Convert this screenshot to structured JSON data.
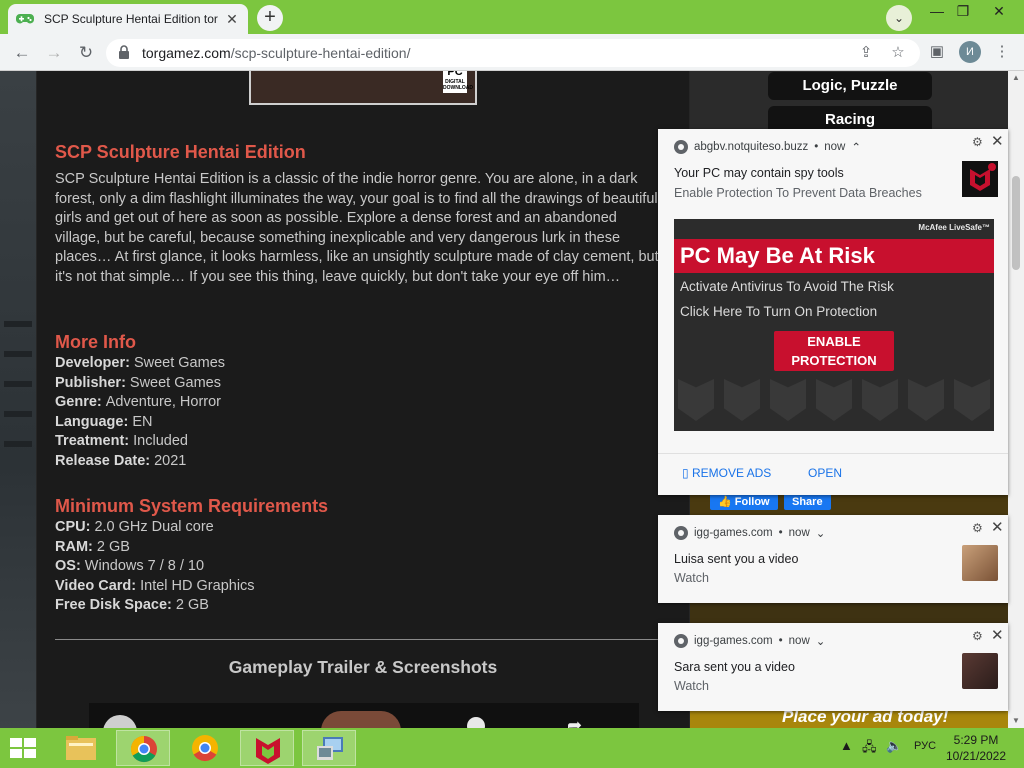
{
  "browser": {
    "tab_title": "SCP Sculpture Hentai Edition tor",
    "url_domain": "torgamez.com",
    "url_path": "/scp-sculpture-hentai-edition/",
    "profile_initial": "И"
  },
  "page": {
    "title": "SCP Sculpture Hentai Edition",
    "description": "SCP Sculpture Hentai Edition is a classic of the indie horror genre. You are alone, in a dark forest, only a dim flashlight illuminates the way, your goal is to find all the drawings of beautiful girls and get out of here as soon as possible. Explore a dense forest and an abandoned village, but be careful, because something inexplicable and very dangerous lurk in these places… At first glance, it looks harmless, like an unsightly sculpture made of clay cement, but it's not that simple… If you see this thing, leave quickly, but don't take your eye off him…",
    "more_info_heading": "More Info",
    "more_info": [
      {
        "key": "Developer:",
        "value": "Sweet Games"
      },
      {
        "key": "Publisher:",
        "value": "Sweet Games"
      },
      {
        "key": "Genre:",
        "value": "Adventure, Horror"
      },
      {
        "key": "Language:",
        "value": "EN"
      },
      {
        "key": "Treatment:",
        "value": "Included"
      },
      {
        "key": "Release Date:",
        "value": "2021"
      }
    ],
    "requirements_heading": "Minimum System Requirements",
    "requirements": [
      {
        "key": "CPU:",
        "value": "2.0 GHz Dual core"
      },
      {
        "key": "RAM:",
        "value": "2 GB"
      },
      {
        "key": "OS:",
        "value": "Windows 7 / 8 / 10"
      },
      {
        "key": "Video Card:",
        "value": "Intel HD Graphics"
      },
      {
        "key": "Free Disk Space:",
        "value": "2 GB"
      }
    ],
    "trailer_heading": "Gameplay Trailer & Screenshots",
    "cover_badge": "PC",
    "cover_badge_small": "DIGITAL DOWNLOAD"
  },
  "sidebar": {
    "genres": [
      "Logic, Puzzle",
      "Racing"
    ],
    "follow_label": "Follow",
    "share_label": "Share",
    "ad_text": "Place your ad today!"
  },
  "notifications": [
    {
      "source": "abgbv.notquiteso.buzz",
      "time": "now",
      "title": "Your PC may contain spy tools",
      "body": "Enable Protection To Prevent Data Breaches",
      "ad": {
        "logo": "McAfee LiveSafe™",
        "headline": "PC May Be At Risk",
        "line1": "Activate Antivirus To Avoid The Risk",
        "line2": "Click Here To Turn On Protection",
        "button": "ENABLE PROTECTION"
      },
      "actions": [
        "REMOVE ADS",
        "OPEN"
      ]
    },
    {
      "source": "igg-games.com",
      "time": "now",
      "title": "Luisa sent you a video",
      "body": "Watch"
    },
    {
      "source": "igg-games.com",
      "time": "now",
      "title": "Sara sent you a video",
      "body": "Watch"
    }
  ],
  "taskbar": {
    "language": "РУС",
    "time": "5:29 PM",
    "date": "10/21/2022"
  },
  "colors": {
    "accent_green": "#7cc63f",
    "heading_red": "#e0584a",
    "mcafee_red": "#c8102e",
    "link_blue": "#1a73e8"
  }
}
